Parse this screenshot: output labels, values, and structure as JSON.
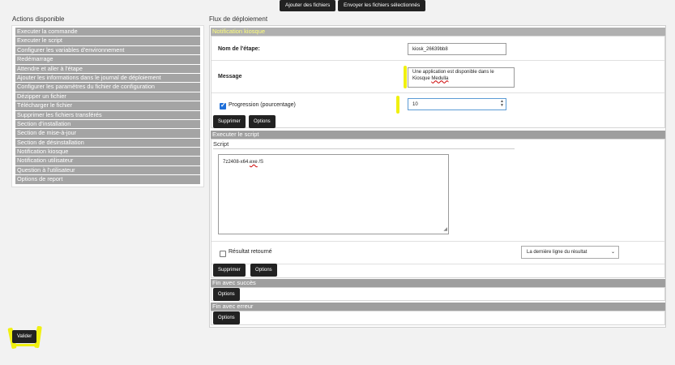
{
  "toolbar": {
    "add_files": "Ajouter des fichiers",
    "send_selected": "Envoyer les fichiers sélectionnés"
  },
  "actions_panel": {
    "title": "Actions disponible",
    "items": [
      "Executer la commande",
      "Executer le script",
      "Configurer les variables d'environnement",
      "Redémarrage",
      "Attendre et aller à l'étape",
      "Ajouter les informations dans le journal de déploiement",
      "Configurer les paramètres du fichier de configuration",
      "Dézipper un fichier",
      "Télécharger le fichier",
      "Supprimer les fichiers transférés",
      "Section d'installation",
      "Section de mise-à-jour",
      "Section de désinstallation",
      "Notification kiosque",
      "Notification utilisateur",
      "Question à l'utilisateur",
      "Options de report"
    ]
  },
  "flow": {
    "title": "Flux de déploiement",
    "kiosk_section": {
      "header": "Notification kiosque",
      "step_name_label": "Nom de l'étape:",
      "step_name_value": "kiosk_26639bb8",
      "message_label": "Message",
      "message_value_prefix": "Une application est disponible dans le Kiosque ",
      "message_value_underlined": "Medulla",
      "progress_label": "Progression (pourcentage)",
      "progress_value": "10",
      "delete_label": "Supprimer",
      "options_label": "Options"
    },
    "script_section": {
      "header": "Executer le script",
      "script_label": "Script",
      "script_prefix": "7z2408-x64.",
      "script_underlined": "exe",
      "script_suffix": " /S",
      "result_label": "Résultat retourné",
      "result_select": "La dernière ligne du résultat",
      "delete_label": "Supprimer",
      "options_label": "Options"
    },
    "success_section": {
      "header": "Fin avec succès",
      "options_label": "Options"
    },
    "error_section": {
      "header": "Fin avec erreur",
      "options_label": "Options"
    }
  },
  "footer": {
    "validate_label": "Valider"
  },
  "colors": {
    "highlight": "#f0f010",
    "button_dark": "#222222",
    "header_grey": "#9e9e9e",
    "checkbox_blue": "#1e6fd9"
  }
}
